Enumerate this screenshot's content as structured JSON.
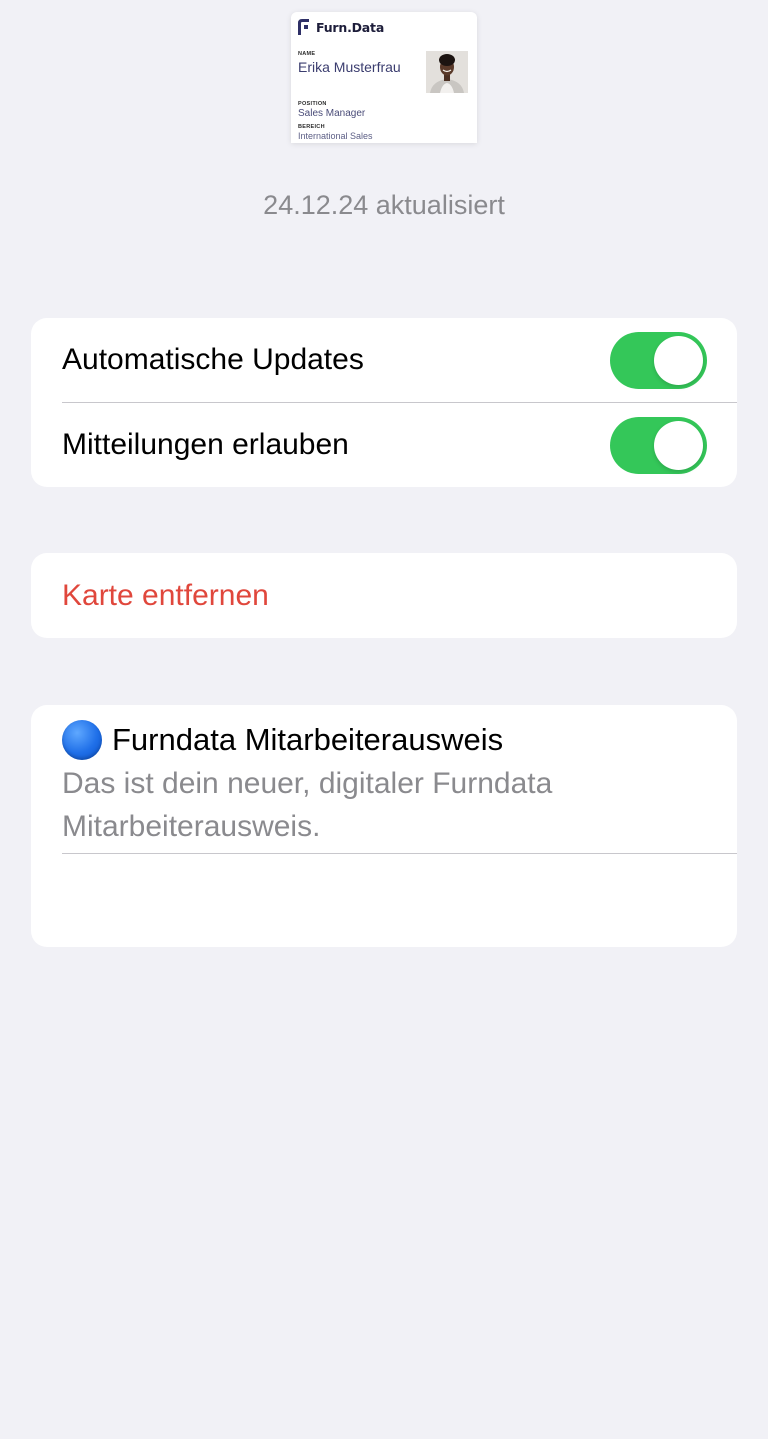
{
  "card": {
    "brand": "Furn.Data",
    "name_label": "NAME",
    "name": "Erika Musterfrau",
    "position_label": "POSITION",
    "position": "Sales Manager",
    "bereich_label": "BEREICH",
    "bereich": "International Sales"
  },
  "updated_text": "24.12.24 aktualisiert",
  "settings": {
    "auto_updates_label": "Automatische Updates",
    "auto_updates_on": true,
    "notifications_label": "Mitteilungen erlauben",
    "notifications_on": true
  },
  "remove_card_label": "Karte entfernen",
  "info": {
    "title": "Furndata Mitarbeiterausweis",
    "description": "Das ist dein neuer, digitaler Furndata Mitarbeiterausweis."
  },
  "icons": {
    "brand_logo": "furndata-logo-icon",
    "status_dot": "blue-circle-icon"
  },
  "colors": {
    "background": "#f1f1f6",
    "toggle_on": "#34c759",
    "destructive": "#e0473c",
    "secondary_text": "#8a8a8e",
    "brand_navy": "#3b3d6f"
  }
}
